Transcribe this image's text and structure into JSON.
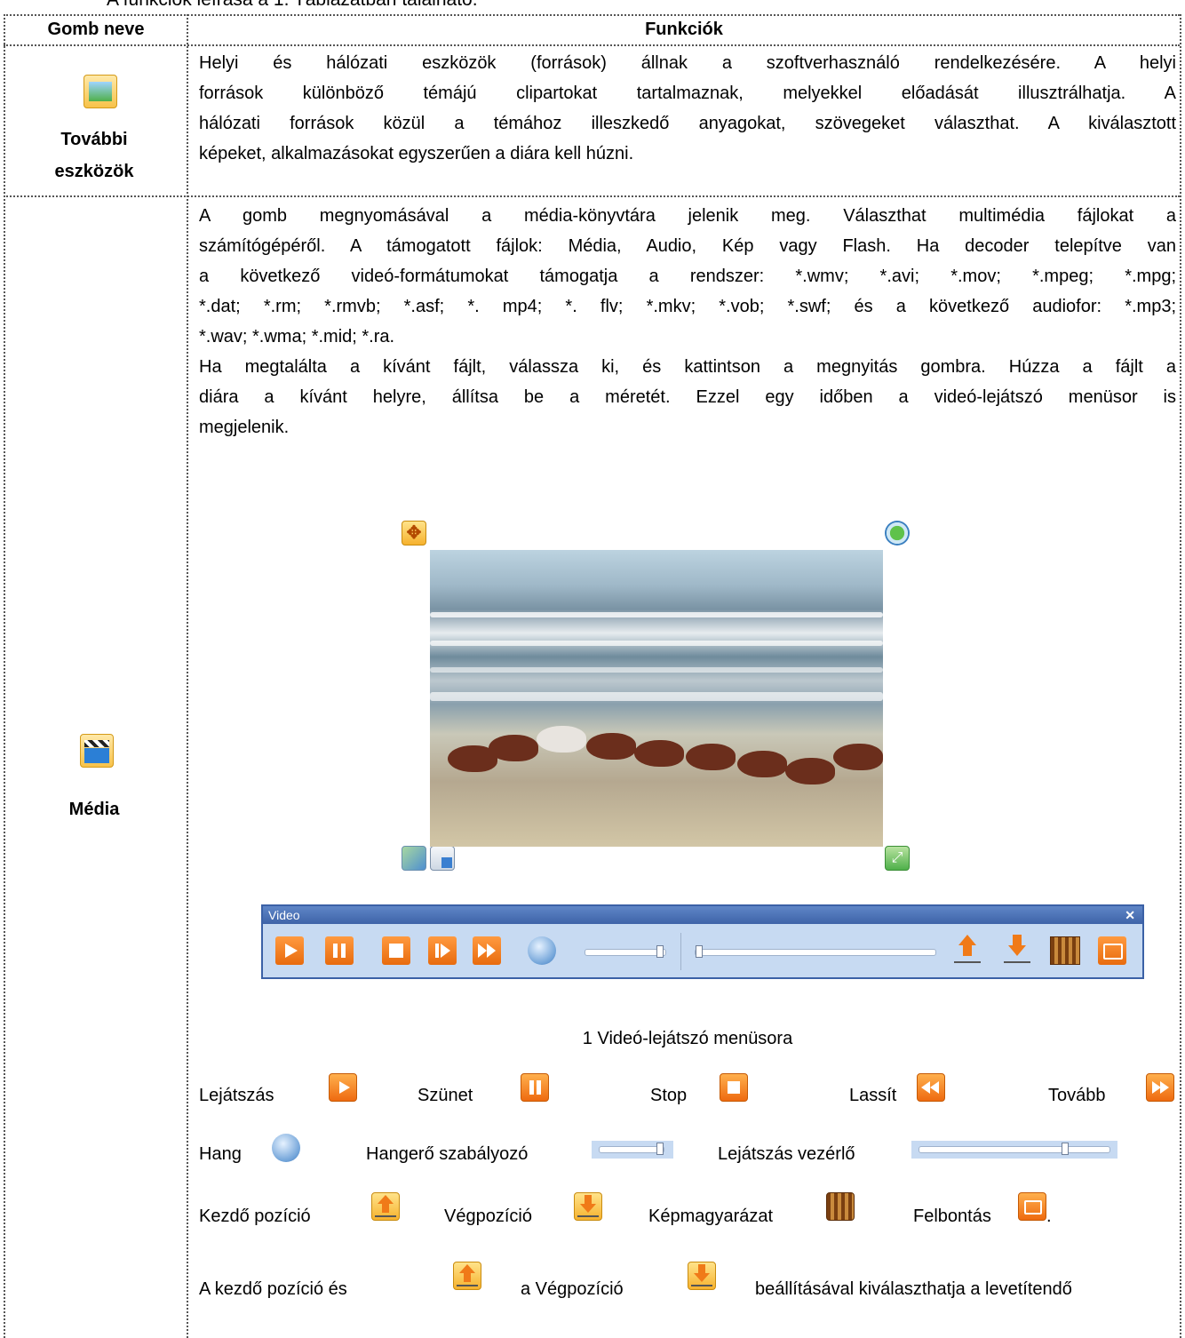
{
  "top_line": "A funkciók leírása a 1. Táblázatban található.",
  "table": {
    "header": {
      "col1": "Gomb neve",
      "col2": "Funkciók"
    },
    "row1": {
      "name_line1": "További",
      "name_line2": "eszközök",
      "lines": [
        "Helyi és hálózati eszközök (források) állnak a szoftverhasználó rendelkezésére. A helyi",
        "források különböző témájú clipartokat tartalmaznak, melyekkel előadását illusztrálhatja. A",
        "hálózati források közül a témához illeszkedő anyagokat, szövegeket választhat. A kiválasztott",
        "képeket, alkalmazásokat egyszerűen a diára kell húzni."
      ]
    },
    "row2": {
      "name": "Média",
      "para1": [
        "A gomb megnyomásával a média-könyvtára jelenik meg. Választhat multimédia fájlokat a",
        "számítógépéről. A támogatott fájlok: Média, Audio, Kép vagy Flash. Ha   decoder telepítve van",
        "a következő videó-formátumokat támogatja a rendszer: *.wmv; *.avi; *.mov; *.mpeg; *.mpg;",
        "*.dat; *.rm; *.rmvb; *.asf; *. mp4; *. flv; *.mkv; *.vob; *.swf; és a következő audiofor: *.mp3;",
        "*.wav; *.wma; *.mid; *.ra."
      ],
      "para2": [
        "Ha megtalálta a kívánt fájlt, válassza ki, és kattintson a megnyitás gombra. Húzza a fájlt a",
        "diára a kívánt helyre, állítsa be a méretét. Ezzel egy időben a videó-lejátszó menüsor is",
        "megjelenik."
      ],
      "toolbar_title": "Video",
      "toolbar_close": "✕",
      "caption": "1 Videó-lejátszó menüsora",
      "legend": {
        "play": "Lejátszás",
        "pause": "Szünet",
        "stop": "Stop",
        "slow": "Lassít",
        "forward": "Tovább",
        "sound": "Hang",
        "volume": "Hangerő szabályozó",
        "playback": "Lejátszás vezérlő",
        "start": "Kezdő pozíció",
        "end": "Végpozíció",
        "caption_btn": "Képmagyarázat",
        "resolution": "Felbontás",
        "resolution_dot": "."
      },
      "last_line": {
        "part1": "A kezdő pozíció és",
        "part2": "a Végpozíció",
        "part3": "beállításával kiválaszthatja a levetítendő"
      }
    }
  },
  "colors": {
    "accent_orange": "#ee6a10",
    "toolbar_blue": "#3e63a8",
    "toolbar_bg": "#c7daf2"
  }
}
